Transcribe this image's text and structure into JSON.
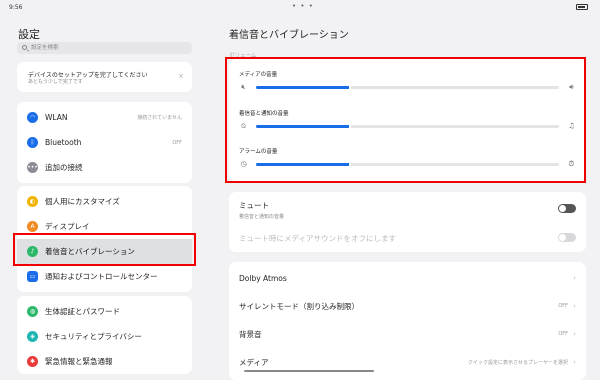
{
  "status": {
    "time": "9:56",
    "dots": "• • •"
  },
  "sidebar": {
    "title": "設定",
    "search_placeholder": "設定を検索",
    "setup": {
      "title": "デバイスのセットアップを完了してください",
      "subtitle": "あともう少しで完了です",
      "close": "×"
    },
    "group1": [
      {
        "label": "WLAN",
        "value": "接続されていません",
        "icon": "wifi-icon",
        "color": "#1a6de8"
      },
      {
        "label": "Bluetooth",
        "value": "OFF",
        "icon": "bluetooth-icon",
        "color": "#1a6de8"
      },
      {
        "label": "追加の接続",
        "value": "",
        "icon": "more-connections-icon",
        "color": "#8c8c95"
      }
    ],
    "group2": [
      {
        "label": "個人用にカスタマイズ",
        "icon": "palette-icon",
        "color": "#f0b400"
      },
      {
        "label": "ディスプレイ",
        "icon": "display-icon",
        "color": "#f08a24"
      },
      {
        "label": "着信音とバイブレーション",
        "icon": "sound-icon",
        "color": "#2cb86a"
      },
      {
        "label": "通知およびコントロールセンター",
        "icon": "notification-icon",
        "color": "#1a6de8"
      }
    ],
    "group3": [
      {
        "label": "生体認証とパスワード",
        "icon": "fingerprint-icon",
        "color": "#2cb86a"
      },
      {
        "label": "セキュリティとプライバシー",
        "icon": "shield-icon",
        "color": "#1fb5b5"
      },
      {
        "label": "緊急情報と緊急通報",
        "icon": "emergency-icon",
        "color": "#e83a3a"
      }
    ]
  },
  "main": {
    "title": "着信音とバイブレーション",
    "section": "ボリューム",
    "volumes": [
      {
        "label": "メディアの音量",
        "level": 0.31,
        "left_icon": "speaker-mute-icon",
        "right_icon": "speaker-icon"
      },
      {
        "label": "着信音と通知の音量",
        "level": 0.31,
        "left_icon": "bell-off-icon",
        "right_icon": "bell-icon"
      },
      {
        "label": "アラームの音量",
        "level": 0.31,
        "left_icon": "alarm-icon",
        "right_icon": "alarm-loud-icon"
      }
    ],
    "mute": {
      "label": "ミュート",
      "sub": "着信音と通知の音量",
      "on": false
    },
    "mute_media": {
      "label": "ミュート時にメディアサウンドをオフにします",
      "on": false
    },
    "list": [
      {
        "label": "Dolby Atmos",
        "value": ""
      },
      {
        "label": "サイレントモード（割り込み制限）",
        "value": "OFF"
      },
      {
        "label": "背景音",
        "value": "OFF"
      },
      {
        "label": "メディア",
        "value": "クイック設定に表示させるプレーヤーを選択"
      }
    ]
  }
}
